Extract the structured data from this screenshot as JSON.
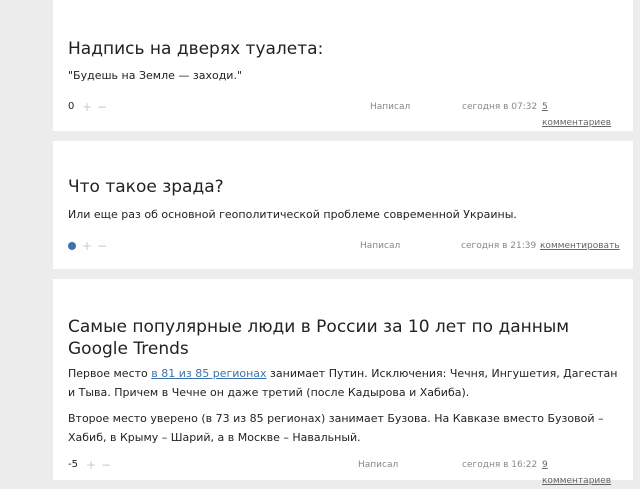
{
  "posts": [
    {
      "title": "Надпись на дверях туалета:",
      "text": "\"Будешь на Земле — заходи.\"",
      "rating": "0",
      "author_label": "Написал",
      "time": "сегодня в 07:32",
      "comments": "5 комментариев"
    },
    {
      "title": "Что такое зрада?",
      "text": "Или еще раз об основной геополитической проблеме современной Украины.",
      "rating": "",
      "author_label": "Написал",
      "time": "сегодня в 21:39",
      "comments": "комментировать"
    },
    {
      "title": "Самые популярные люди в России за 10 лет по данным Google Trends",
      "text_p1_before": "Первое место ",
      "text_p1_link": "в 81 из 85 регионах",
      "text_p1_after": " занимает Путин. Исключения: Чечня, Ингушетия, Дагестан и Тыва. Причем в Чечне он даже третий (после Кадырова и Хабиба).",
      "text_p2": "Второе место уверено (в 73 из 85 регионах) занимает Бузова. На Кавказе вместо Бузовой – Хабиб, в Крыму – Шарий, а в Москве – Навальный.",
      "rating": "-5",
      "author_label": "Написал",
      "time": "сегодня в 16:22",
      "comments": "9 комментариев"
    }
  ],
  "controls": {
    "plus": "+",
    "minus": "−"
  },
  "colors": {
    "accent": "#3b73af",
    "background": "#ececec",
    "card": "#ffffff"
  }
}
